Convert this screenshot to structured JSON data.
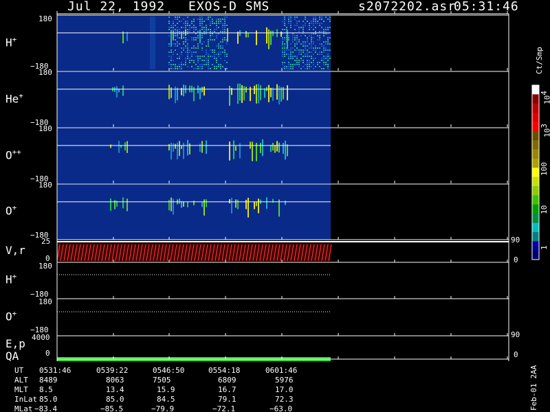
{
  "header": {
    "date": "Jul 22, 1992",
    "instrument": "EXOS-D SMS",
    "filename": "s2072202.asr",
    "time": "05:31:46"
  },
  "panels": {
    "h_plus": {
      "label": "H",
      "sup": "+",
      "tick_top": "180",
      "tick_bottom": "−180"
    },
    "he_plus": {
      "label": "He",
      "sup": "+",
      "tick_top": "180",
      "tick_bottom": "−180"
    },
    "o_pp": {
      "label": "O",
      "sup": "++",
      "tick_top": "180",
      "tick_bottom": "−180"
    },
    "o_plus": {
      "label": "O",
      "sup": "+",
      "tick_top": "180",
      "tick_bottom": "−180"
    },
    "vr": {
      "label": "V,r",
      "tick_top": "25",
      "tick_bottom": "0",
      "right_top": "90",
      "right_bottom": "0"
    },
    "h_plus_2": {
      "label": "H",
      "sup": "+",
      "tick_top": "180",
      "tick_bottom": "−180"
    },
    "o_plus_2": {
      "label": "O",
      "sup": "+",
      "tick_top": "180",
      "tick_bottom": "−180"
    },
    "ep": {
      "label": "E,p",
      "tick_top": "4000",
      "right_top": "90"
    },
    "qa": {
      "label": "QA",
      "tick_bottom": "0",
      "right_bottom": "0"
    }
  },
  "colorbar": {
    "title": "Ct/Smp",
    "labels": [
      "10",
      "10",
      "100",
      "10",
      "1"
    ],
    "sups": [
      "4",
      "3",
      "",
      "",
      ""
    ],
    "colors": [
      "#ffffff",
      "#8b0000",
      "#c00000",
      "#e00000",
      "#ff0000",
      "#6b4f00",
      "#806a00",
      "#9a8600",
      "#b0a000",
      "#ffff00",
      "#c8e000",
      "#8ccc00",
      "#40c000",
      "#00a000",
      "#009040",
      "#00c0c0",
      "#008080",
      "#0000a0",
      "#000070"
    ]
  },
  "footer": {
    "labels": [
      "UT",
      "ALT",
      "MLT",
      "InLat",
      "MLat"
    ],
    "columns": [
      [
        "0531:46",
        "8489",
        "8.5",
        "85.0",
        "−83.4"
      ],
      [
        "0539:22",
        "8063",
        "13.4",
        "85.0",
        "−85.5"
      ],
      [
        "0546:50",
        "7505",
        "15.9",
        "84.5",
        "−79.9"
      ],
      [
        "0554:18",
        "6809",
        "16.7",
        "79.1",
        "−72.1"
      ],
      [
        "0601:46",
        "5976",
        "17.0",
        "72.3",
        "−63.0"
      ]
    ],
    "stamp": "Feb-01 2AA"
  }
}
